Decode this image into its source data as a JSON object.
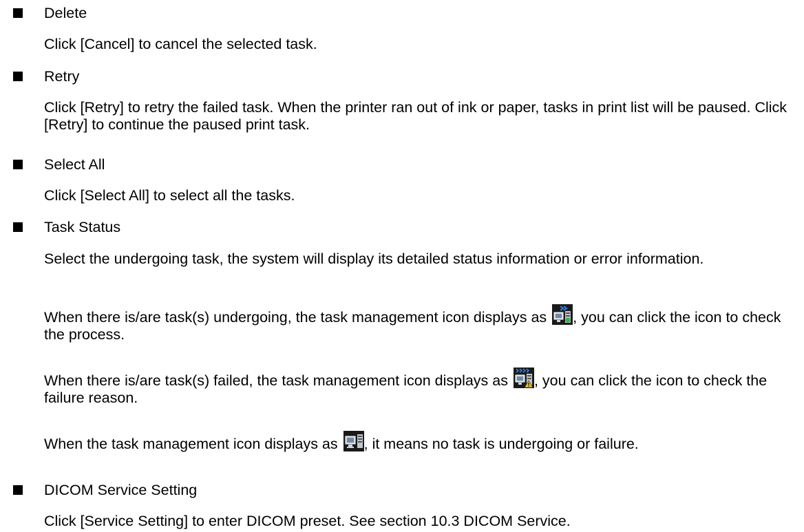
{
  "sections": [
    {
      "heading": "Delete",
      "paragraphs": [
        "Click [Cancel] to cancel the selected task."
      ]
    },
    {
      "heading": "Retry",
      "paragraphs": [
        "Click [Retry] to retry the failed task. When the printer ran out of ink or paper, tasks in print list will be paused. Click [Retry] to continue the paused print task."
      ]
    },
    {
      "heading": "Select All",
      "paragraphs": [
        "Click [Select All] to select all the tasks."
      ]
    },
    {
      "heading": "Task Status",
      "paragraphs": [
        "Select the undergoing task, the system will display its detailed status information or error information.",
        {
          "before": "When there is/are task(s) undergoing, the task management icon displays as",
          "icon": "task-undergoing-icon",
          "after": ", you can click the icon to check the process."
        },
        {
          "before": "When there is/are task(s) failed, the task management icon displays as",
          "icon": "task-failed-icon",
          "after": ", you can click the icon to check the failure reason."
        },
        {
          "before": "When the task management icon displays as",
          "icon": "task-idle-icon",
          "after": ", it means no task is undergoing or failure."
        }
      ]
    },
    {
      "heading": "DICOM Service Setting",
      "paragraphs": [
        "Click [Service Setting] to enter DICOM preset. See section 10.3 DICOM Service."
      ]
    }
  ],
  "colors": {
    "text": "#000000",
    "icon_background": "#1a1a1a",
    "icon_arrow_blue": "#2e7bd6",
    "icon_status_green": "#2fb34a",
    "icon_warning_yellow": "#f2c31b"
  }
}
